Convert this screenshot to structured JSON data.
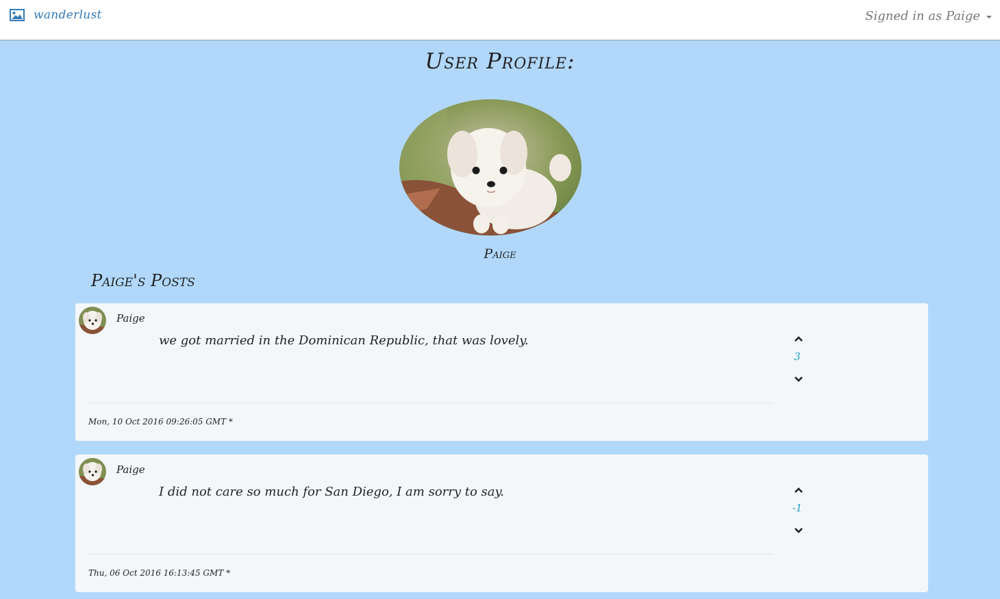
{
  "navbar": {
    "brand_label": "wanderlust",
    "brand_icon": "image-icon",
    "signed_in_label": "Signed in as Paige",
    "dropdown_icon": "caret-down-icon"
  },
  "profile": {
    "page_title": "User Profile:",
    "name": "Paige",
    "avatar": "puppy-photo",
    "posts_heading": "Paige's Posts"
  },
  "posts": [
    {
      "author": "Paige",
      "body": "we got married in the Dominican Republic, that was lovely.",
      "votes": "3",
      "date": "Mon, 10 Oct 2016 09:26:05 GMT *"
    },
    {
      "author": "Paige",
      "body": "I did not care so much for San Diego, I am sorry to say.",
      "votes": "-1",
      "date": "Thu, 06 Oct 2016 16:13:45 GMT *"
    }
  ],
  "colors": {
    "background": "#b1d8fb",
    "link": "#337ab7",
    "vote_count": "#1c9fc4",
    "card": "#f4f7fa"
  }
}
